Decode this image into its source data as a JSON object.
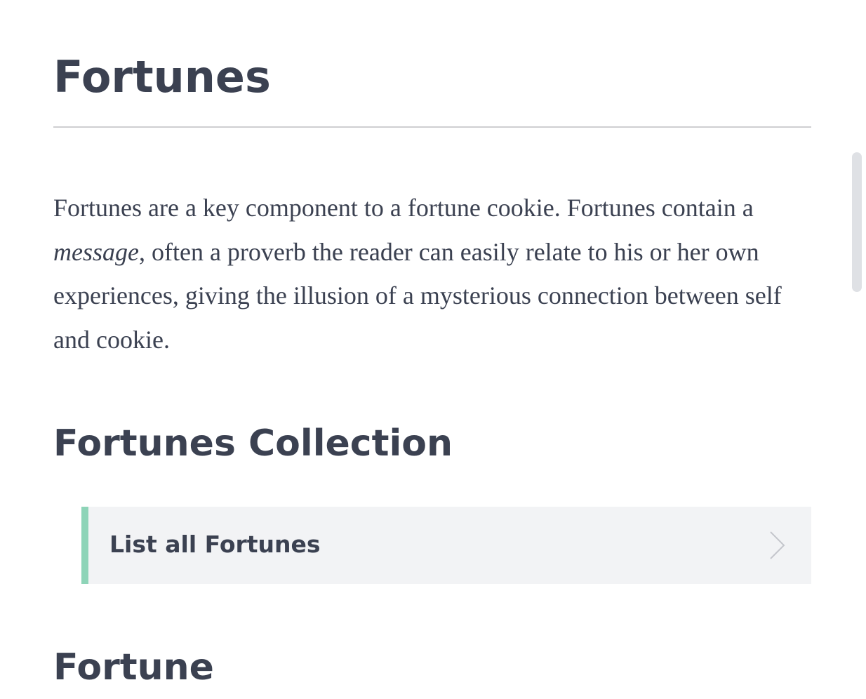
{
  "page": {
    "title": "Fortunes"
  },
  "intro": {
    "part1": "Fortunes are a key component to a fortune cookie. Fortunes contain a ",
    "emphasis": "message",
    "part2": ", often a proverb the reader can easily relate to his or her own experiences, giving the illusion of a mysterious connection between self and cookie."
  },
  "sections": {
    "collection": {
      "heading": "Fortunes Collection",
      "actions": [
        {
          "label": "List all Fortunes",
          "icon": "chevron-right-icon"
        }
      ]
    },
    "fortune": {
      "heading": "Fortune"
    }
  },
  "colors": {
    "text": "#3b4151",
    "accent_border": "#8ed4b8",
    "action_background": "#f2f3f5",
    "rule": "#cfcfd1",
    "scrollbar": "#dfe1e5"
  }
}
